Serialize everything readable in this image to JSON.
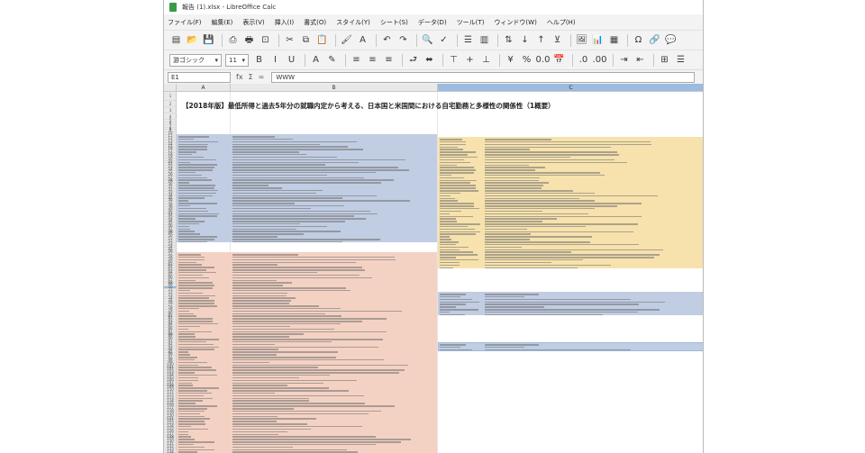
{
  "window": {
    "title": "報告 (1).xlsx - LibreOffice Calc"
  },
  "menu": [
    "ファイル(F)",
    "編集(E)",
    "表示(V)",
    "挿入(I)",
    "書式(O)",
    "スタイル(Y)",
    "シート(S)",
    "データ(D)",
    "ツール(T)",
    "ウィンドウ(W)",
    "ヘルプ(H)"
  ],
  "toolbar1": [
    {
      "name": "new-document-icon",
      "glyph": "▤"
    },
    {
      "name": "open-icon",
      "glyph": "📂"
    },
    {
      "name": "save-icon",
      "glyph": "💾"
    },
    {
      "name": "sep",
      "glyph": ""
    },
    {
      "name": "export-pdf-icon",
      "glyph": "⎙"
    },
    {
      "name": "print-icon",
      "glyph": "🖶"
    },
    {
      "name": "print-preview-icon",
      "glyph": "⊡"
    },
    {
      "name": "sep",
      "glyph": ""
    },
    {
      "name": "cut-icon",
      "glyph": "✂"
    },
    {
      "name": "copy-icon",
      "glyph": "⧉"
    },
    {
      "name": "paste-icon",
      "glyph": "📋"
    },
    {
      "name": "sep",
      "glyph": ""
    },
    {
      "name": "clone-format-icon",
      "glyph": "🖌"
    },
    {
      "name": "clear-format-icon",
      "glyph": "A"
    },
    {
      "name": "sep",
      "glyph": ""
    },
    {
      "name": "undo-icon",
      "glyph": "↶"
    },
    {
      "name": "redo-icon",
      "glyph": "↷"
    },
    {
      "name": "sep",
      "glyph": ""
    },
    {
      "name": "find-replace-icon",
      "glyph": "🔍"
    },
    {
      "name": "spelling-icon",
      "glyph": "✓"
    },
    {
      "name": "sep",
      "glyph": ""
    },
    {
      "name": "row-icon",
      "glyph": "☰"
    },
    {
      "name": "column-icon",
      "glyph": "▥"
    },
    {
      "name": "sep",
      "glyph": ""
    },
    {
      "name": "sort-icon",
      "glyph": "⇅"
    },
    {
      "name": "sort-ascending-icon",
      "glyph": "↓"
    },
    {
      "name": "sort-descending-icon",
      "glyph": "↑"
    },
    {
      "name": "autofilter-icon",
      "glyph": "⊻"
    },
    {
      "name": "sep",
      "glyph": ""
    },
    {
      "name": "insert-image-icon",
      "glyph": "🖼"
    },
    {
      "name": "insert-chart-icon",
      "glyph": "📊"
    },
    {
      "name": "pivot-table-icon",
      "glyph": "▦"
    },
    {
      "name": "sep",
      "glyph": ""
    },
    {
      "name": "special-character-icon",
      "glyph": "Ω"
    },
    {
      "name": "hyperlink-icon",
      "glyph": "🔗"
    },
    {
      "name": "comment-icon",
      "glyph": "💬"
    }
  ],
  "toolbar2": {
    "font_name": "游ゴシック",
    "font_size": "11",
    "buttons": [
      {
        "name": "bold-icon",
        "glyph": "B"
      },
      {
        "name": "italic-icon",
        "glyph": "I"
      },
      {
        "name": "underline-icon",
        "glyph": "U"
      },
      {
        "name": "sep",
        "glyph": ""
      },
      {
        "name": "font-color-icon",
        "glyph": "A"
      },
      {
        "name": "highlight-color-icon",
        "glyph": "✎"
      },
      {
        "name": "sep",
        "glyph": ""
      },
      {
        "name": "align-left-icon",
        "glyph": "≡"
      },
      {
        "name": "align-center-icon",
        "glyph": "≡"
      },
      {
        "name": "align-right-icon",
        "glyph": "≡"
      },
      {
        "name": "sep",
        "glyph": ""
      },
      {
        "name": "wrap-text-icon",
        "glyph": "⮐"
      },
      {
        "name": "merge-center-icon",
        "glyph": "⬌"
      },
      {
        "name": "sep",
        "glyph": ""
      },
      {
        "name": "align-top-icon",
        "glyph": "⊤"
      },
      {
        "name": "align-middle-icon",
        "glyph": "+"
      },
      {
        "name": "align-bottom-icon",
        "glyph": "⊥"
      },
      {
        "name": "sep",
        "glyph": ""
      },
      {
        "name": "currency-format-icon",
        "glyph": "¥"
      },
      {
        "name": "percent-format-icon",
        "glyph": "%"
      },
      {
        "name": "number-format-icon",
        "glyph": "0.0"
      },
      {
        "name": "date-format-icon",
        "glyph": "📅"
      },
      {
        "name": "sep",
        "glyph": ""
      },
      {
        "name": "add-decimal-icon",
        "glyph": ".0"
      },
      {
        "name": "delete-decimal-icon",
        "glyph": ".00"
      },
      {
        "name": "sep",
        "glyph": ""
      },
      {
        "name": "increase-indent-icon",
        "glyph": "⇥"
      },
      {
        "name": "decrease-indent-icon",
        "glyph": "⇤"
      },
      {
        "name": "sep",
        "glyph": ""
      },
      {
        "name": "borders-icon",
        "glyph": "⊞"
      },
      {
        "name": "border-style-icon",
        "glyph": "☰"
      }
    ]
  },
  "formula_bar": {
    "cell_ref": "E1",
    "content": "WWW"
  },
  "columns": [
    {
      "label": "A",
      "selected": false
    },
    {
      "label": "B",
      "selected": false
    },
    {
      "label": "C",
      "selected": true
    }
  ],
  "row_labels": [
    "1",
    "2",
    "3",
    "4",
    "5",
    "6",
    "7",
    "8",
    "9",
    "10",
    "11",
    "12",
    "13",
    "14",
    "15",
    "16",
    "17",
    "18",
    "19",
    "20",
    "21",
    "22",
    "23",
    "24",
    "25",
    "26",
    "27",
    "28",
    "29",
    "30",
    "31",
    "32",
    "33",
    "34",
    "35",
    "36",
    "37",
    "38",
    "39",
    "40",
    "41",
    "42",
    "43",
    "44",
    "45",
    "46",
    "47",
    "48",
    "49",
    "50",
    "51",
    "52",
    "53",
    "54",
    "55",
    "56",
    "57",
    "58",
    "59",
    "60",
    "61",
    "62",
    "63",
    "64",
    "65",
    "66",
    "67",
    "68",
    "69",
    "70",
    "71",
    "72",
    "73",
    "74",
    "75",
    "76",
    "77",
    "78",
    "79",
    "80",
    "81",
    "82",
    "83",
    "84",
    "85",
    "86",
    "87",
    "88",
    "89",
    "90",
    "91",
    "92",
    "93",
    "94",
    "95",
    "96",
    "97",
    "98",
    "99",
    "100",
    "101",
    "102",
    "103",
    "104",
    "105",
    "106",
    "107",
    "108",
    "109",
    "110",
    "111",
    "112",
    "113",
    "114",
    "115",
    "116",
    "117",
    "118",
    "119",
    "120",
    "121",
    "122",
    "123",
    "124",
    "125",
    "126",
    "127",
    "128",
    "129",
    "130",
    "131",
    "132",
    "133",
    "134",
    "135",
    "136",
    "137",
    "138"
  ],
  "selected_row": "70",
  "sheet": {
    "title": "【2018年版】最低所得と過去5年分の就職内定から考える、日本国と米国間における自宅勤務と多様性の関係性（1概要）"
  },
  "colors": {
    "blue_block": "#c1cde3",
    "salmon_block": "#f4d2c3",
    "yellow_block": "#f7e2ad",
    "selection": "#9bbbdf"
  }
}
